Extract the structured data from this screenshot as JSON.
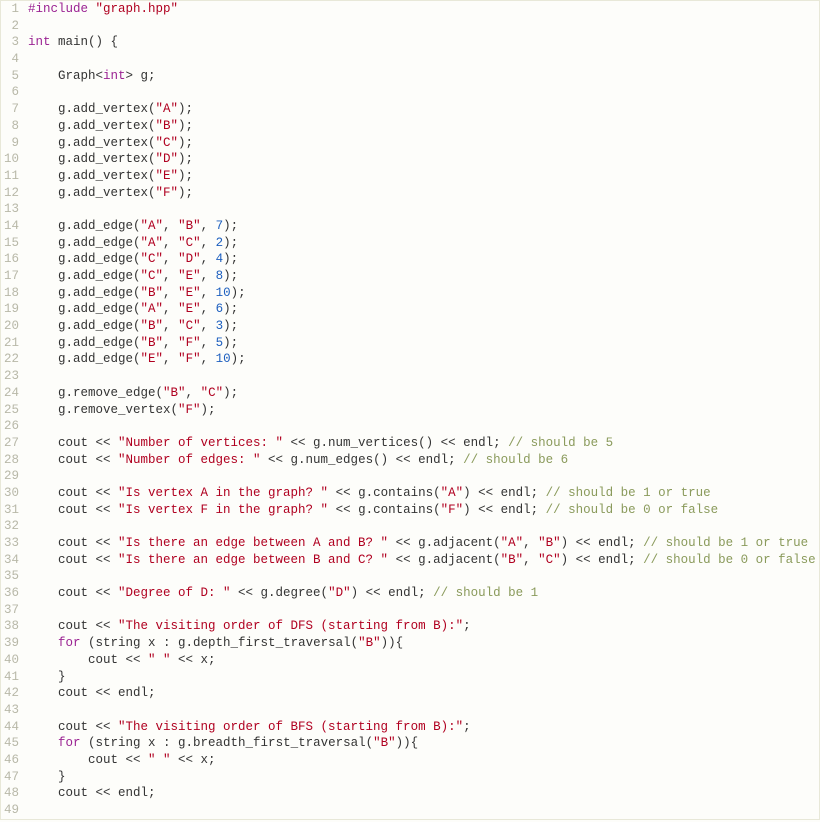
{
  "lines": [
    {
      "n": 1,
      "t": [
        {
          "c": "pp",
          "s": "#include "
        },
        {
          "c": "str",
          "s": "\"graph.hpp\""
        }
      ]
    },
    {
      "n": 2,
      "t": []
    },
    {
      "n": 3,
      "t": [
        {
          "c": "kw",
          "s": "int"
        },
        {
          "c": "txt",
          "s": " main() {"
        }
      ]
    },
    {
      "n": 4,
      "t": []
    },
    {
      "n": 5,
      "t": [
        {
          "c": "txt",
          "s": "    Graph<"
        },
        {
          "c": "kw",
          "s": "int"
        },
        {
          "c": "txt",
          "s": "> g;"
        }
      ]
    },
    {
      "n": 6,
      "t": []
    },
    {
      "n": 7,
      "t": [
        {
          "c": "txt",
          "s": "    g.add_vertex("
        },
        {
          "c": "str",
          "s": "\"A\""
        },
        {
          "c": "txt",
          "s": ");"
        }
      ]
    },
    {
      "n": 8,
      "t": [
        {
          "c": "txt",
          "s": "    g.add_vertex("
        },
        {
          "c": "str",
          "s": "\"B\""
        },
        {
          "c": "txt",
          "s": ");"
        }
      ]
    },
    {
      "n": 9,
      "t": [
        {
          "c": "txt",
          "s": "    g.add_vertex("
        },
        {
          "c": "str",
          "s": "\"C\""
        },
        {
          "c": "txt",
          "s": ");"
        }
      ]
    },
    {
      "n": 10,
      "t": [
        {
          "c": "txt",
          "s": "    g.add_vertex("
        },
        {
          "c": "str",
          "s": "\"D\""
        },
        {
          "c": "txt",
          "s": ");"
        }
      ]
    },
    {
      "n": 11,
      "t": [
        {
          "c": "txt",
          "s": "    g.add_vertex("
        },
        {
          "c": "str",
          "s": "\"E\""
        },
        {
          "c": "txt",
          "s": ");"
        }
      ]
    },
    {
      "n": 12,
      "t": [
        {
          "c": "txt",
          "s": "    g.add_vertex("
        },
        {
          "c": "str",
          "s": "\"F\""
        },
        {
          "c": "txt",
          "s": ");"
        }
      ]
    },
    {
      "n": 13,
      "t": []
    },
    {
      "n": 14,
      "t": [
        {
          "c": "txt",
          "s": "    g.add_edge("
        },
        {
          "c": "str",
          "s": "\"A\""
        },
        {
          "c": "txt",
          "s": ", "
        },
        {
          "c": "str",
          "s": "\"B\""
        },
        {
          "c": "txt",
          "s": ", "
        },
        {
          "c": "num",
          "s": "7"
        },
        {
          "c": "txt",
          "s": ");"
        }
      ]
    },
    {
      "n": 15,
      "t": [
        {
          "c": "txt",
          "s": "    g.add_edge("
        },
        {
          "c": "str",
          "s": "\"A\""
        },
        {
          "c": "txt",
          "s": ", "
        },
        {
          "c": "str",
          "s": "\"C\""
        },
        {
          "c": "txt",
          "s": ", "
        },
        {
          "c": "num",
          "s": "2"
        },
        {
          "c": "txt",
          "s": ");"
        }
      ]
    },
    {
      "n": 16,
      "t": [
        {
          "c": "txt",
          "s": "    g.add_edge("
        },
        {
          "c": "str",
          "s": "\"C\""
        },
        {
          "c": "txt",
          "s": ", "
        },
        {
          "c": "str",
          "s": "\"D\""
        },
        {
          "c": "txt",
          "s": ", "
        },
        {
          "c": "num",
          "s": "4"
        },
        {
          "c": "txt",
          "s": ");"
        }
      ]
    },
    {
      "n": 17,
      "t": [
        {
          "c": "txt",
          "s": "    g.add_edge("
        },
        {
          "c": "str",
          "s": "\"C\""
        },
        {
          "c": "txt",
          "s": ", "
        },
        {
          "c": "str",
          "s": "\"E\""
        },
        {
          "c": "txt",
          "s": ", "
        },
        {
          "c": "num",
          "s": "8"
        },
        {
          "c": "txt",
          "s": ");"
        }
      ]
    },
    {
      "n": 18,
      "t": [
        {
          "c": "txt",
          "s": "    g.add_edge("
        },
        {
          "c": "str",
          "s": "\"B\""
        },
        {
          "c": "txt",
          "s": ", "
        },
        {
          "c": "str",
          "s": "\"E\""
        },
        {
          "c": "txt",
          "s": ", "
        },
        {
          "c": "num",
          "s": "10"
        },
        {
          "c": "txt",
          "s": ");"
        }
      ]
    },
    {
      "n": 19,
      "t": [
        {
          "c": "txt",
          "s": "    g.add_edge("
        },
        {
          "c": "str",
          "s": "\"A\""
        },
        {
          "c": "txt",
          "s": ", "
        },
        {
          "c": "str",
          "s": "\"E\""
        },
        {
          "c": "txt",
          "s": ", "
        },
        {
          "c": "num",
          "s": "6"
        },
        {
          "c": "txt",
          "s": ");"
        }
      ]
    },
    {
      "n": 20,
      "t": [
        {
          "c": "txt",
          "s": "    g.add_edge("
        },
        {
          "c": "str",
          "s": "\"B\""
        },
        {
          "c": "txt",
          "s": ", "
        },
        {
          "c": "str",
          "s": "\"C\""
        },
        {
          "c": "txt",
          "s": ", "
        },
        {
          "c": "num",
          "s": "3"
        },
        {
          "c": "txt",
          "s": ");"
        }
      ]
    },
    {
      "n": 21,
      "t": [
        {
          "c": "txt",
          "s": "    g.add_edge("
        },
        {
          "c": "str",
          "s": "\"B\""
        },
        {
          "c": "txt",
          "s": ", "
        },
        {
          "c": "str",
          "s": "\"F\""
        },
        {
          "c": "txt",
          "s": ", "
        },
        {
          "c": "num",
          "s": "5"
        },
        {
          "c": "txt",
          "s": ");"
        }
      ]
    },
    {
      "n": 22,
      "t": [
        {
          "c": "txt",
          "s": "    g.add_edge("
        },
        {
          "c": "str",
          "s": "\"E\""
        },
        {
          "c": "txt",
          "s": ", "
        },
        {
          "c": "str",
          "s": "\"F\""
        },
        {
          "c": "txt",
          "s": ", "
        },
        {
          "c": "num",
          "s": "10"
        },
        {
          "c": "txt",
          "s": ");"
        }
      ]
    },
    {
      "n": 23,
      "t": []
    },
    {
      "n": 24,
      "t": [
        {
          "c": "txt",
          "s": "    g.remove_edge("
        },
        {
          "c": "str",
          "s": "\"B\""
        },
        {
          "c": "txt",
          "s": ", "
        },
        {
          "c": "str",
          "s": "\"C\""
        },
        {
          "c": "txt",
          "s": ");"
        }
      ]
    },
    {
      "n": 25,
      "t": [
        {
          "c": "txt",
          "s": "    g.remove_vertex("
        },
        {
          "c": "str",
          "s": "\"F\""
        },
        {
          "c": "txt",
          "s": ");"
        }
      ]
    },
    {
      "n": 26,
      "t": []
    },
    {
      "n": 27,
      "t": [
        {
          "c": "txt",
          "s": "    cout << "
        },
        {
          "c": "str",
          "s": "\"Number of vertices: \""
        },
        {
          "c": "txt",
          "s": " << g.num_vertices() << endl; "
        },
        {
          "c": "cmt",
          "s": "// should be 5"
        }
      ]
    },
    {
      "n": 28,
      "t": [
        {
          "c": "txt",
          "s": "    cout << "
        },
        {
          "c": "str",
          "s": "\"Number of edges: \""
        },
        {
          "c": "txt",
          "s": " << g.num_edges() << endl; "
        },
        {
          "c": "cmt",
          "s": "// should be 6"
        }
      ]
    },
    {
      "n": 29,
      "t": []
    },
    {
      "n": 30,
      "t": [
        {
          "c": "txt",
          "s": "    cout << "
        },
        {
          "c": "str",
          "s": "\"Is vertex A in the graph? \""
        },
        {
          "c": "txt",
          "s": " << g.contains("
        },
        {
          "c": "str",
          "s": "\"A\""
        },
        {
          "c": "txt",
          "s": ") << endl; "
        },
        {
          "c": "cmt",
          "s": "// should be 1 or true"
        }
      ]
    },
    {
      "n": 31,
      "t": [
        {
          "c": "txt",
          "s": "    cout << "
        },
        {
          "c": "str",
          "s": "\"Is vertex F in the graph? \""
        },
        {
          "c": "txt",
          "s": " << g.contains("
        },
        {
          "c": "str",
          "s": "\"F\""
        },
        {
          "c": "txt",
          "s": ") << endl; "
        },
        {
          "c": "cmt",
          "s": "// should be 0 or false"
        }
      ]
    },
    {
      "n": 32,
      "t": []
    },
    {
      "n": 33,
      "t": [
        {
          "c": "txt",
          "s": "    cout << "
        },
        {
          "c": "str",
          "s": "\"Is there an edge between A and B? \""
        },
        {
          "c": "txt",
          "s": " << g.adjacent("
        },
        {
          "c": "str",
          "s": "\"A\""
        },
        {
          "c": "txt",
          "s": ", "
        },
        {
          "c": "str",
          "s": "\"B\""
        },
        {
          "c": "txt",
          "s": ") << endl; "
        },
        {
          "c": "cmt",
          "s": "// should be 1 or true"
        }
      ]
    },
    {
      "n": 34,
      "t": [
        {
          "c": "txt",
          "s": "    cout << "
        },
        {
          "c": "str",
          "s": "\"Is there an edge between B and C? \""
        },
        {
          "c": "txt",
          "s": " << g.adjacent("
        },
        {
          "c": "str",
          "s": "\"B\""
        },
        {
          "c": "txt",
          "s": ", "
        },
        {
          "c": "str",
          "s": "\"C\""
        },
        {
          "c": "txt",
          "s": ") << endl; "
        },
        {
          "c": "cmt",
          "s": "// should be 0 or false"
        }
      ]
    },
    {
      "n": 35,
      "t": []
    },
    {
      "n": 36,
      "t": [
        {
          "c": "txt",
          "s": "    cout << "
        },
        {
          "c": "str",
          "s": "\"Degree of D: \""
        },
        {
          "c": "txt",
          "s": " << g.degree("
        },
        {
          "c": "str",
          "s": "\"D\""
        },
        {
          "c": "txt",
          "s": ") << endl; "
        },
        {
          "c": "cmt",
          "s": "// should be 1"
        }
      ]
    },
    {
      "n": 37,
      "t": []
    },
    {
      "n": 38,
      "t": [
        {
          "c": "txt",
          "s": "    cout << "
        },
        {
          "c": "str",
          "s": "\"The visiting order of DFS (starting from B):\""
        },
        {
          "c": "txt",
          "s": ";"
        }
      ]
    },
    {
      "n": 39,
      "t": [
        {
          "c": "txt",
          "s": "    "
        },
        {
          "c": "kw",
          "s": "for"
        },
        {
          "c": "txt",
          "s": " (string x : g.depth_first_traversal("
        },
        {
          "c": "str",
          "s": "\"B\""
        },
        {
          "c": "txt",
          "s": ")){"
        }
      ]
    },
    {
      "n": 40,
      "t": [
        {
          "c": "txt",
          "s": "        cout << "
        },
        {
          "c": "str",
          "s": "\" \""
        },
        {
          "c": "txt",
          "s": " << x;"
        }
      ]
    },
    {
      "n": 41,
      "t": [
        {
          "c": "txt",
          "s": "    }"
        }
      ]
    },
    {
      "n": 42,
      "t": [
        {
          "c": "txt",
          "s": "    cout << endl;"
        }
      ]
    },
    {
      "n": 43,
      "t": []
    },
    {
      "n": 44,
      "t": [
        {
          "c": "txt",
          "s": "    cout << "
        },
        {
          "c": "str",
          "s": "\"The visiting order of BFS (starting from B):\""
        },
        {
          "c": "txt",
          "s": ";"
        }
      ]
    },
    {
      "n": 45,
      "t": [
        {
          "c": "txt",
          "s": "    "
        },
        {
          "c": "kw",
          "s": "for"
        },
        {
          "c": "txt",
          "s": " (string x : g.breadth_first_traversal("
        },
        {
          "c": "str",
          "s": "\"B\""
        },
        {
          "c": "txt",
          "s": ")){"
        }
      ]
    },
    {
      "n": 46,
      "t": [
        {
          "c": "txt",
          "s": "        cout << "
        },
        {
          "c": "str",
          "s": "\" \""
        },
        {
          "c": "txt",
          "s": " << x;"
        }
      ]
    },
    {
      "n": 47,
      "t": [
        {
          "c": "txt",
          "s": "    }"
        }
      ]
    },
    {
      "n": 48,
      "t": [
        {
          "c": "txt",
          "s": "    cout << endl;"
        }
      ]
    },
    {
      "n": 49,
      "t": []
    }
  ]
}
